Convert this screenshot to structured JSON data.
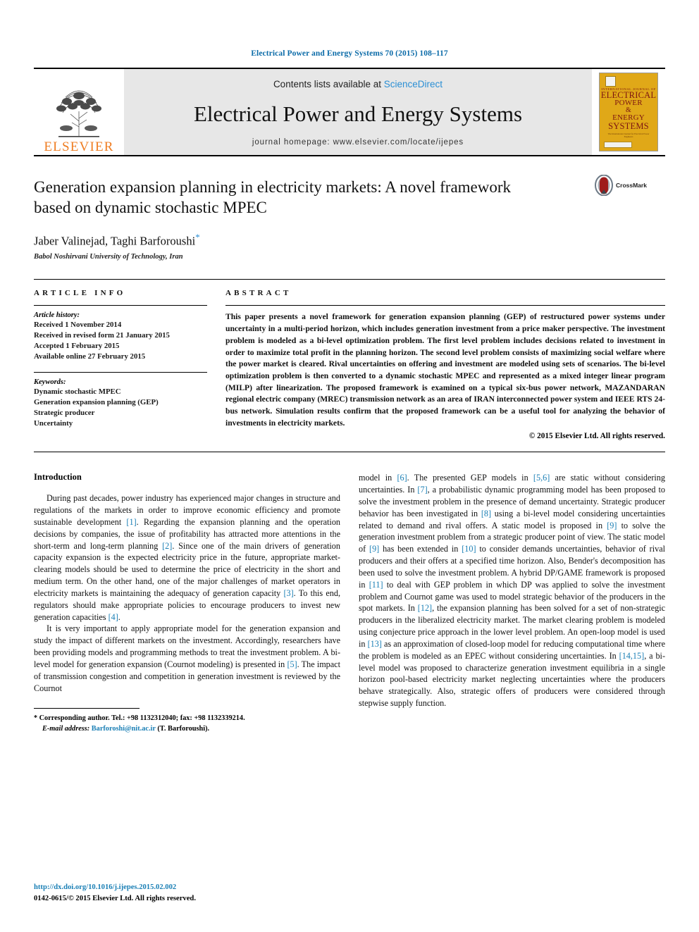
{
  "running_head": "Electrical Power and Energy Systems 70 (2015) 108–117",
  "masthead": {
    "contents_prefix": "Contents lists available at ",
    "sciencedirect": "ScienceDirect",
    "journal_title": "Electrical Power and Energy Systems",
    "homepage": "journal homepage: www.elsevier.com/locate/ijepes",
    "publisher_name": "ELSEVIER",
    "cover": {
      "superline": "INTERNATIONAL JOURNAL OF",
      "line1": "ELECTRICAL",
      "line2": "POWER",
      "line3": "&",
      "line4": "ENERGY",
      "line5": "SYSTEMS",
      "footline": "The International Journal for Electrical Power Engineers"
    },
    "colors": {
      "link_blue": "#2b8fd4",
      "elsevier_orange": "#ef7d22",
      "cover_gold": "#e0a818",
      "cover_text_red": "#7d1511",
      "panel_grey": "#e7e7e7"
    }
  },
  "article": {
    "title": "Generation expansion planning in electricity markets: A novel framework based on dynamic stochastic MPEC",
    "authors": "Jaber Valinejad, Taghi Barforoushi",
    "corresponding_marker": "*",
    "affiliation": "Babol Noshirvani University of Technology, Iran",
    "crossmark_label": "CrossMark"
  },
  "article_info": {
    "heading": "ARTICLE INFO",
    "history_label": "Article history:",
    "history": [
      "Received 1 November 2014",
      "Received in revised form 21 January 2015",
      "Accepted 1 February 2015",
      "Available online 27 February 2015"
    ],
    "keywords_label": "Keywords:",
    "keywords": [
      "Dynamic stochastic MPEC",
      "Generation expansion planning (GEP)",
      "Strategic producer",
      "Uncertainty"
    ]
  },
  "abstract": {
    "heading": "ABSTRACT",
    "text": "This paper presents a novel framework for generation expansion planning (GEP) of restructured power systems under uncertainty in a multi-period horizon, which includes generation investment from a price maker perspective. The investment problem is modeled as a bi-level optimization problem. The first level problem includes decisions related to investment in order to maximize total profit in the planning horizon. The second level problem consists of maximizing social welfare where the power market is cleared. Rival uncertainties on offering and investment are modeled using sets of scenarios. The bi-level optimization problem is then converted to a dynamic stochastic MPEC and represented as a mixed integer linear program (MILP) after linearization. The proposed framework is examined on a typical six-bus power network, MAZANDARAN regional electric company (MREC) transmission network as an area of IRAN interconnected power system and IEEE RTS 24-bus network. Simulation results confirm that the proposed framework can be a useful tool for analyzing the behavior of investments in electricity markets.",
    "copyright": "© 2015 Elsevier Ltd. All rights reserved."
  },
  "body": {
    "section_heading": "Introduction",
    "left_paragraphs": [
      "During past decades, power industry has experienced major changes in structure and regulations of the markets in order to improve economic efficiency and promote sustainable development [1]. Regarding the expansion planning and the operation decisions by companies, the issue of profitability has attracted more attentions in the short-term and long-term planning [2]. Since one of the main drivers of generation capacity expansion is the expected electricity price in the future, appropriate market-clearing models should be used to determine the price of electricity in the short and medium term. On the other hand, one of the major challenges of market operators in electricity markets is maintaining the adequacy of generation capacity [3]. To this end, regulators should make appropriate policies to encourage producers to invest new generation capacities [4].",
      "It is very important to apply appropriate model for the generation expansion and study the impact of different markets on the investment. Accordingly, researchers have been providing models and programming methods to treat the investment problem. A bi-level model for generation expansion (Cournot modeling) is presented in [5]. The impact of transmission congestion and competition in generation investment is reviewed by the Cournot"
    ],
    "right_paragraphs": [
      "model in [6]. The presented GEP models in [5,6] are static without considering uncertainties. In [7], a probabilistic dynamic programming model has been proposed to solve the investment problem in the presence of demand uncertainty. Strategic producer behavior has been investigated in [8] using a bi-level model considering uncertainties related to demand and rival offers. A static model is proposed in [9] to solve the generation investment problem from a strategic producer point of view. The static model of [9] has been extended in [10] to consider demands uncertainties, behavior of rival producers and their offers at a specified time horizon. Also, Bender's decomposition has been used to solve the investment problem. A hybrid DP/GAME framework is proposed in [11] to deal with GEP problem in which DP was applied to solve the investment problem and Cournot game was used to model strategic behavior of the producers in the spot markets. In [12], the expansion planning has been solved for a set of non-strategic producers in the liberalized electricity market. The market clearing problem is modeled using conjecture price approach in the lower level problem. An open-loop model is used in [13] as an approximation of closed-loop model for reducing computational time where the problem is modeled as an EPEC without considering uncertainties. In [14,15], a bi-level model was proposed to characterize generation investment equilibria in a single horizon pool-based electricity market neglecting uncertainties where the producers behave strategically. Also, strategic offers of producers were considered through stepwise supply function."
    ]
  },
  "footnote": {
    "star": "*",
    "line1": "Corresponding author. Tel.: +98 1132312040; fax: +98 1132339214.",
    "email_label": "E-mail address:",
    "email": "Barforoshi@nit.ac.ir",
    "email_suffix": "(T. Barforoushi)."
  },
  "page_footer": {
    "doi": "http://dx.doi.org/10.1016/j.ijepes.2015.02.002",
    "issn_line": "0142-0615/© 2015 Elsevier Ltd. All rights reserved."
  }
}
